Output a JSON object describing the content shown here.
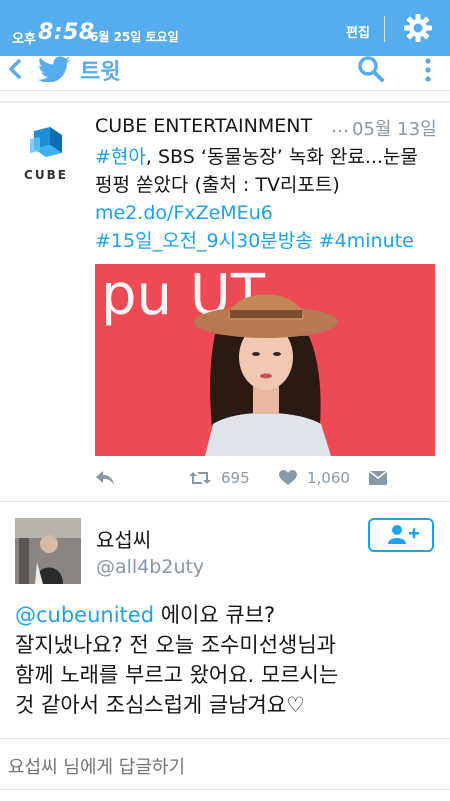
{
  "status_bar": {
    "ampm": "오후",
    "time": "8:58",
    "date": "6월 25일 토요일",
    "edit_label": "편집",
    "settings_icon": "gear-icon"
  },
  "app_bar": {
    "title": "트윗",
    "back_icon": "chevron-left-icon",
    "logo_icon": "twitter-bird-icon",
    "search_icon": "search-icon",
    "more_icon": "more-vertical-icon"
  },
  "tweet1": {
    "name": "CUBE ENTERTAINMENT",
    "ellipsis": "...",
    "date": "05월 13일",
    "logo_text": "CUBE",
    "text_lines": [
      {
        "link": "#현아",
        "rest": ", SBS ‘동물농장’ 녹화 완료...눈물"
      },
      {
        "text": "펑펑 쏟았다 (출처 : TV리포트)"
      },
      {
        "link": "me2.do/FxZeMEu6"
      },
      {
        "link": "#15일_오전_9시30분방송 #4minute"
      }
    ],
    "image_text": "pu  UT",
    "retweet_count": "695",
    "like_count": "1,060"
  },
  "tweet2": {
    "name": "요섭씨",
    "handle": "@all4b2uty",
    "text_lines": [
      {
        "link": "@cubeunited",
        "rest": " 에이요 큐브?"
      },
      {
        "text": "잘지냈나요? 전 오늘 조수미선생님과"
      },
      {
        "text": "함께 노래를 부르고 왔어요. 모르시는"
      },
      {
        "text": "것 같아서 조심스럽게 글남겨요♡"
      }
    ]
  },
  "reply_bar": {
    "placeholder": "요섭씨 님에게 답글하기"
  },
  "colors": {
    "twitter_blue": "#55acee",
    "link_blue": "#1da1f2",
    "gray_text": "#8899a6",
    "photo_red": "#ee4a55"
  }
}
